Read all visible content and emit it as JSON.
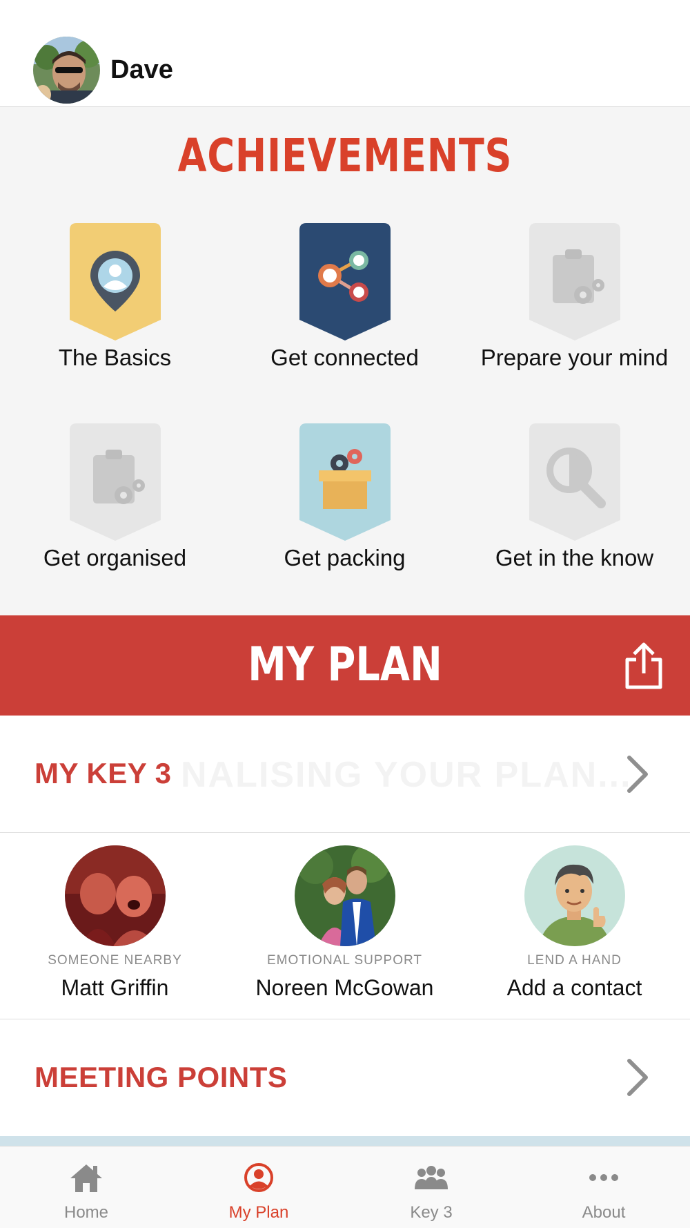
{
  "header": {
    "user_name": "Dave"
  },
  "achievements": {
    "title": "ACHIEVEMENTS",
    "badges": [
      {
        "label": "The Basics",
        "state": "earned",
        "color": "#f2cd74"
      },
      {
        "label": "Get connected",
        "state": "earned",
        "color": "#2b4a72"
      },
      {
        "label": "Prepare your mind",
        "state": "locked",
        "color": "#e6e6e6"
      },
      {
        "label": "Get organised",
        "state": "locked",
        "color": "#e6e6e6"
      },
      {
        "label": "Get packing",
        "state": "earned",
        "color": "#aed6df"
      },
      {
        "label": "Get in the know",
        "state": "locked",
        "color": "#e6e6e6"
      }
    ]
  },
  "plan": {
    "title": "MY PLAN",
    "share_icon": "share-icon"
  },
  "key3_section": {
    "label": "MY KEY 3",
    "ghost_text": "NALISING YOUR PLAN..."
  },
  "contacts": [
    {
      "role": "SOMEONE NEARBY",
      "name": "Matt Griffin"
    },
    {
      "role": "EMOTIONAL SUPPORT",
      "name": "Noreen McGowan"
    },
    {
      "role": "LEND A HAND",
      "name": "Add a contact"
    }
  ],
  "meeting_section": {
    "label": "MEETING POINTS"
  },
  "tabs": [
    {
      "label": "Home",
      "icon": "home-icon",
      "active": false
    },
    {
      "label": "My Plan",
      "icon": "user-circle-icon",
      "active": true
    },
    {
      "label": "Key 3",
      "icon": "group-icon",
      "active": false
    },
    {
      "label": "About",
      "icon": "more-icon",
      "active": false
    }
  ],
  "colors": {
    "accent": "#cb3f38",
    "title_red": "#d9412a",
    "inactive": "#8a8a8a"
  }
}
